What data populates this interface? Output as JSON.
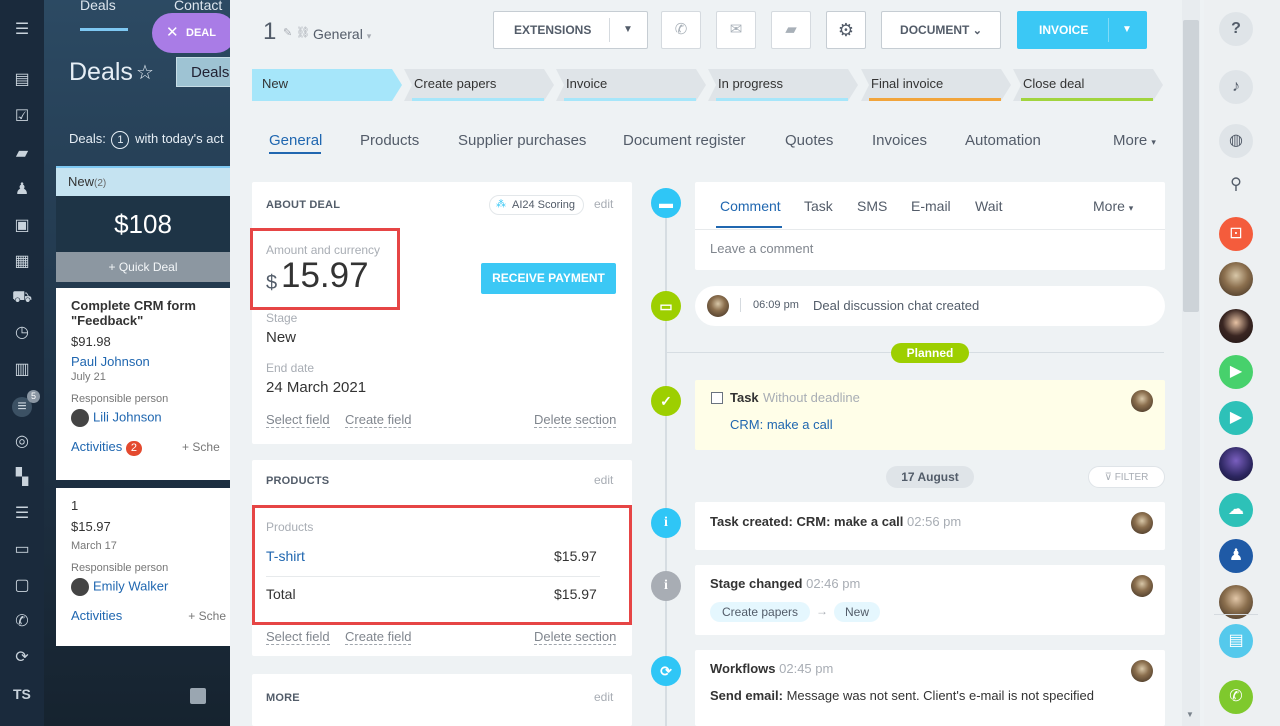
{
  "background": {
    "tabs": [
      "Deals",
      "Contact"
    ],
    "deal_pill": "DEAL",
    "title": "Deals",
    "deals_button": "Deals",
    "count_prefix": "Deals:",
    "count_num": "1",
    "count_suffix": "with today's act",
    "column_name": "New",
    "column_count": "(2)",
    "column_sum": "$108",
    "quick_deal": "+ Quick Deal",
    "cards": [
      {
        "title": "Complete CRM form \"Feedback\"",
        "amount": "$91.98",
        "contact": "Paul Johnson",
        "date": "July 21",
        "resp_label": "Responsible person",
        "resp_name": "Lili Johnson",
        "activities": "Activities",
        "activities_badge": "2",
        "schedule": "+ Sche"
      },
      {
        "title": "1",
        "amount": "$15.97",
        "date": "March 17",
        "resp_label": "Responsible person",
        "resp_name": "Emily Walker",
        "activities": "Activities",
        "schedule": "+ Sche"
      }
    ]
  },
  "left_rail": {
    "badge": "5",
    "initials": "TS"
  },
  "header": {
    "deal_number": "1",
    "category": "General",
    "extensions": "EXTENSIONS",
    "document": "DOCUMENT",
    "invoice": "INVOICE"
  },
  "stages": [
    "New",
    "Create papers",
    "Invoice",
    "In progress",
    "Final invoice",
    "Close deal"
  ],
  "stage_colors": [
    "#a6e6fa",
    "#a6e6fa",
    "#a6e6fa",
    "#a6e6fa",
    "#f1a43b",
    "#a1d43e"
  ],
  "tabs": [
    "General",
    "Products",
    "Supplier purchases",
    "Document register",
    "Quotes",
    "Invoices",
    "Automation",
    "More"
  ],
  "about": {
    "title": "ABOUT DEAL",
    "scoring": "AI24 Scoring",
    "edit": "edit",
    "amount_label": "Amount and currency",
    "currency": "$",
    "amount": "15.97",
    "receive_payment": "RECEIVE PAYMENT",
    "stage_label": "Stage",
    "stage_value": "New",
    "end_date_label": "End date",
    "end_date_value": "24 March 2021",
    "select_field": "Select field",
    "create_field": "Create field",
    "delete_section": "Delete section"
  },
  "products": {
    "title": "PRODUCTS",
    "edit": "edit",
    "label": "Products",
    "item_name": "T-shirt",
    "item_price": "$15.97",
    "total_label": "Total",
    "total_value": "$15.97",
    "select_field": "Select field",
    "create_field": "Create field",
    "delete_section": "Delete section"
  },
  "more_section": {
    "title": "MORE",
    "edit": "edit"
  },
  "timeline": {
    "tabs": [
      "Comment",
      "Task",
      "SMS",
      "E-mail",
      "Wait",
      "More"
    ],
    "comment_placeholder": "Leave a comment",
    "chat_time": "06:09 pm",
    "chat_text": "Deal discussion chat created",
    "planned": "Planned",
    "task_title": "Task",
    "task_deadline": "Without deadline",
    "task_link": "CRM: make a call",
    "date_pill": "17 August",
    "filter": "FILTER",
    "entries": [
      {
        "title": "Task created: CRM: make a call",
        "time": "02:56 pm"
      },
      {
        "title": "Stage changed",
        "time": "02:46 pm",
        "from": "Create papers",
        "arrow": "→",
        "to": "New"
      },
      {
        "title": "Workflows",
        "time": "02:45 pm",
        "detail_bold": "Send email:",
        "detail": "Message was not sent. Client's e-mail is not specified"
      }
    ]
  }
}
